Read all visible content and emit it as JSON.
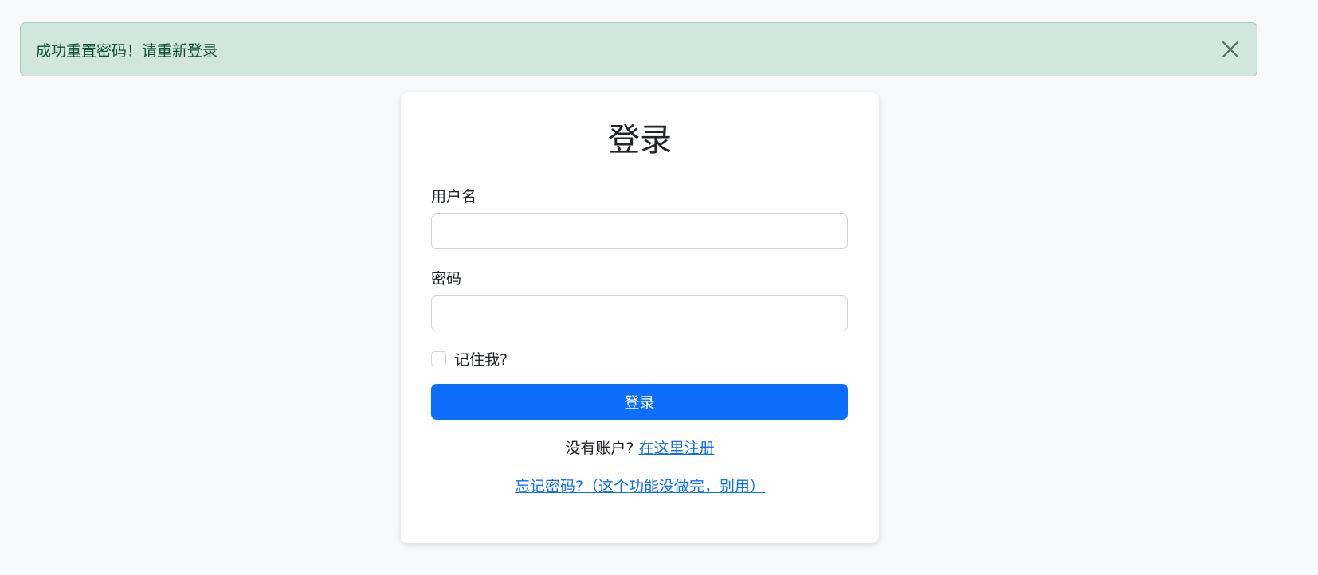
{
  "alert": {
    "message": "成功重置密码！请重新登录",
    "close_icon": "close-icon",
    "background": "#d1e7dd",
    "text_color": "#0f5132"
  },
  "login": {
    "title": "登录",
    "username_label": "用户名",
    "username_value": "",
    "password_label": "密码",
    "password_value": "",
    "remember_label": "记住我?",
    "remember_checked": false,
    "submit_label": "登录",
    "no_account_text": "没有账户?",
    "register_link": "在这里注册",
    "forgot_link": "忘记密码?（这个功能没做完，别用）"
  },
  "colors": {
    "primary": "#0d6efd",
    "page_background": "#f8f9fa"
  }
}
